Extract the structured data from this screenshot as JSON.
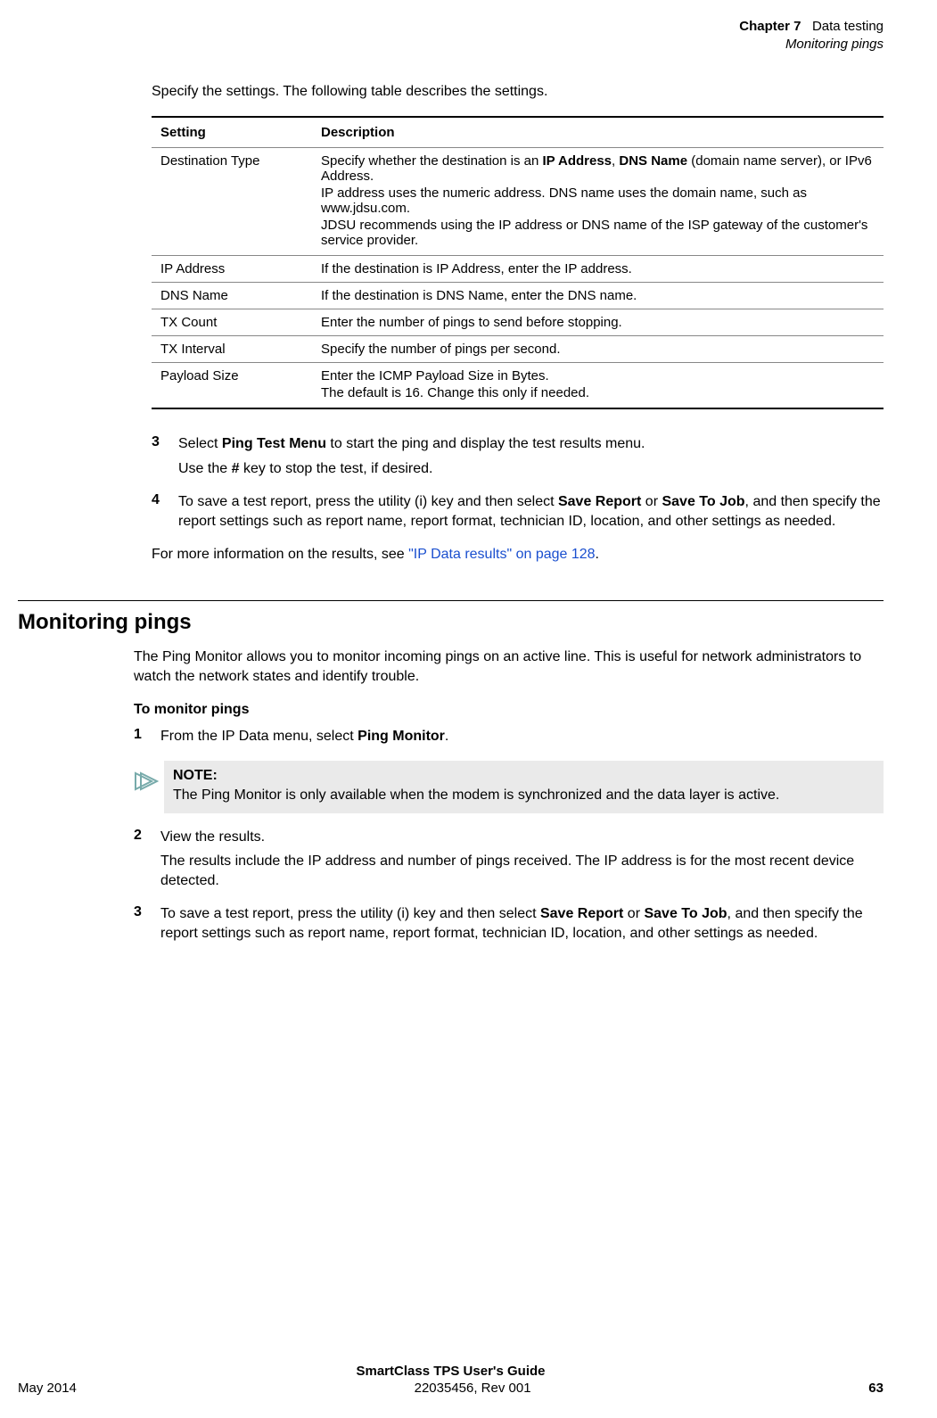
{
  "header": {
    "chapter_label": "Chapter 7",
    "chapter_title": "Data testing",
    "section_title": "Monitoring pings"
  },
  "intro": "Specify the settings. The following table describes the settings.",
  "table": {
    "col1": "Setting",
    "col2": "Description",
    "rows": [
      {
        "setting": "Destination Type",
        "desc1a": "Specify whether the destination is an ",
        "desc1b": "IP Address",
        "desc1c": ", ",
        "desc1d": "DNS Name",
        "desc1e": " (domain name server), or IPv6 Address.",
        "desc2": "IP address uses the numeric address. DNS name uses the domain name, such as www.jdsu.com.",
        "desc3": "JDSU recommends using the IP address or DNS name of the ISP gateway of the customer's service provider."
      },
      {
        "setting": "IP Address",
        "desc": "If the destination is IP Address, enter the IP address."
      },
      {
        "setting": "DNS Name",
        "desc": "If the destination is DNS Name, enter the DNS name."
      },
      {
        "setting": "TX Count",
        "desc": "Enter the number of pings to send before stopping."
      },
      {
        "setting": "TX Interval",
        "desc": "Specify the number of pings per second."
      },
      {
        "setting": "Payload Size",
        "desc_a": "Enter the ICMP Payload Size in Bytes.",
        "desc_b": "The default is 16. Change this only if needed."
      }
    ]
  },
  "steps_top": {
    "s3_num": "3",
    "s3a": "Select ",
    "s3b": "Ping Test Menu",
    "s3c": " to start the ping and display the test results menu.",
    "s3_sub_a": "Use the ",
    "s3_sub_b": "#",
    "s3_sub_c": " key to stop the test, if desired.",
    "s4_num": "4",
    "s4a": "To save a test report, press the utility (i) key and then select ",
    "s4b": "Save Report",
    "s4c": " or ",
    "s4d": "Save To Job",
    "s4e": ", and then specify the report settings such as report name, report format, technician ID, location, and other settings as needed."
  },
  "info": {
    "a": "For more information on the results, see ",
    "link": "\"IP Data results\" on page 128",
    "b": "."
  },
  "section": {
    "heading": "Monitoring pings",
    "intro": "The Ping Monitor allows you to monitor incoming pings on an active line. This is useful for network administrators to watch the network states and identify trouble.",
    "subheading": "To monitor pings",
    "s1_num": "1",
    "s1a": "From the IP Data menu, select ",
    "s1b": "Ping Monitor",
    "s1c": ".",
    "note_title": "NOTE:",
    "note_body": "The Ping Monitor is only available when the modem is synchronized and the data layer is active.",
    "s2_num": "2",
    "s2a": "View the results.",
    "s2_sub": "The results include the IP address and number of pings received. The IP address is for the most recent device detected.",
    "s3_num": "3",
    "s3a": "To save a test report, press the utility (i) key and then select ",
    "s3b": "Save Report",
    "s3c": " or ",
    "s3d": "Save To Job",
    "s3e": ", and then specify the report settings such as report name, report format, technician ID, location, and other settings as needed."
  },
  "footer": {
    "title": "SmartClass TPS User's Guide",
    "left": "May 2014",
    "mid": "22035456, Rev 001",
    "right": "63"
  }
}
